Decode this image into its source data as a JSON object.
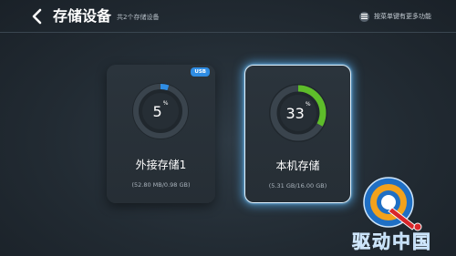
{
  "header": {
    "title": "存储设备",
    "subtitle": "共2个存储设备",
    "menu_hint": "按菜单键有更多功能"
  },
  "devices": [
    {
      "name": "外接存储1",
      "percent": 5,
      "percent_unit": "%",
      "size": "(52.80 MB/0.98 GB)",
      "badge": "USB",
      "ring_color": "#2f8de4",
      "selected": false
    },
    {
      "name": "本机存储",
      "percent": 33,
      "percent_unit": "%",
      "size": "(5.31 GB/16.00 GB)",
      "ring_color": "#5ebd2a",
      "selected": true
    }
  ],
  "watermark": {
    "text": "驱动中国"
  },
  "icons": {
    "back": "chevron-left-icon",
    "menu": "menu-icon"
  }
}
